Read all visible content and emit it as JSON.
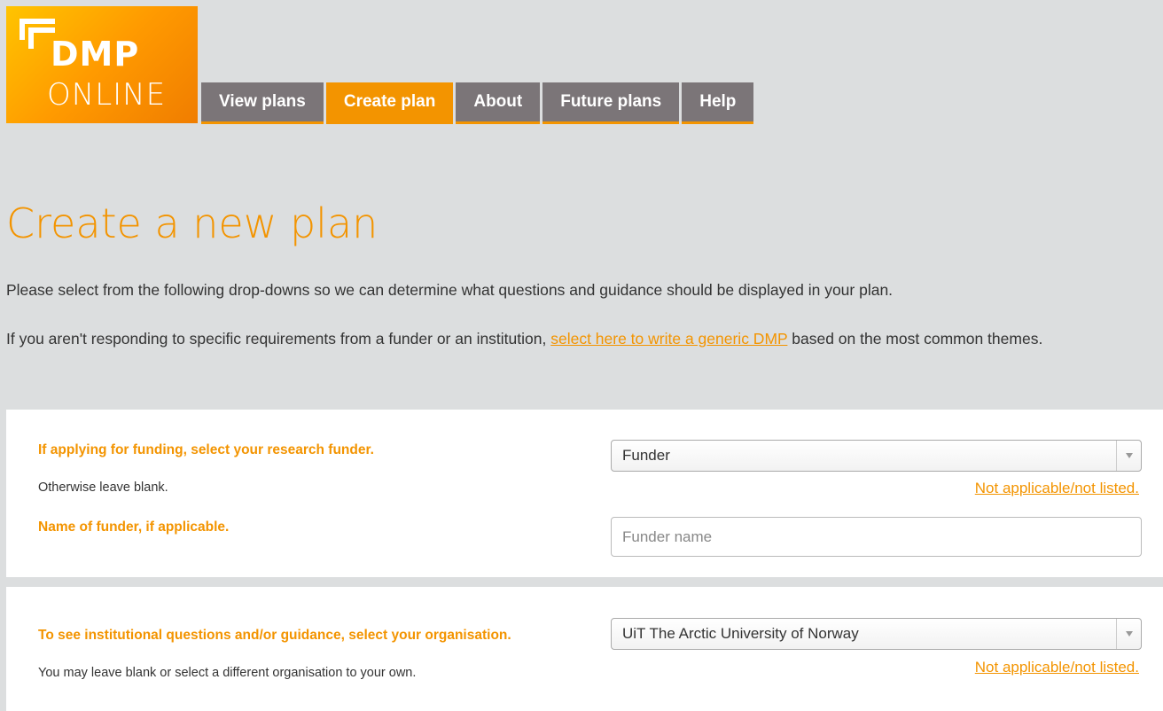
{
  "logo": {
    "line1": "DMP",
    "line2": "ONLINE"
  },
  "nav": {
    "items": [
      {
        "label": "View plans",
        "active": false
      },
      {
        "label": "Create plan",
        "active": true
      },
      {
        "label": "About",
        "active": false
      },
      {
        "label": "Future plans",
        "active": false
      },
      {
        "label": "Help",
        "active": false
      }
    ]
  },
  "page": {
    "title": "Create a new plan",
    "intro1": "Please select from the following drop-downs so we can determine what questions and guidance should be displayed in your plan.",
    "intro2_before": "If you aren't responding to specific requirements from a funder or an institution, ",
    "intro2_link": "select here to write a generic DMP",
    "intro2_after": " based on the most common themes."
  },
  "funder_panel": {
    "question": "If applying for funding, select your research funder.",
    "hint": "Otherwise leave blank.",
    "select_value": "Funder",
    "not_applicable": "Not applicable/not listed.",
    "name_label": "Name of funder, if applicable.",
    "name_placeholder": "Funder name"
  },
  "org_panel": {
    "question": "To see institutional questions and/or guidance, select your organisation.",
    "hint": "You may leave blank or select a different organisation to your own.",
    "select_value": "UiT The Arctic University of Norway",
    "not_applicable": "Not applicable/not listed."
  },
  "colors": {
    "accent": "#f39400",
    "nav_bg": "#7b7578",
    "page_bg": "#dcdedf"
  },
  "icons": [
    "logo-mark-icon",
    "chevron-down-icon"
  ]
}
